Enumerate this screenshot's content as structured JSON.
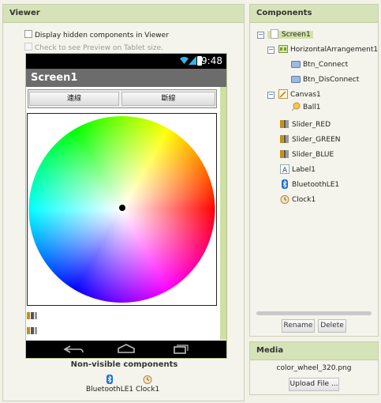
{
  "viewer": {
    "title": "Viewer",
    "hidden_components_label": "Display hidden components in Viewer",
    "tablet_preview_label": "Check to see Preview on Tablet size.",
    "phone": {
      "status_time": "9:48",
      "screen_title": "Screen1",
      "btn_connect_label": "連線",
      "btn_disconnect_label": "斷線"
    },
    "nonvisible_title": "Non-visible components",
    "nonvisible": [
      "BluetoothLE1",
      "Clock1"
    ]
  },
  "components": {
    "title": "Components",
    "tree": {
      "screen1": "Screen1",
      "harr": "HorizontalArrangement1",
      "btn_connect": "Btn_Connect",
      "btn_disconnect": "Btn_DisConnect",
      "canvas": "Canvas1",
      "ball": "Ball1",
      "slider_red": "Slider_RED",
      "slider_green": "Slider_GREEN",
      "slider_blue": "Slider_BLUE",
      "label": "Label1",
      "bluetooth": "BluetoothLE1",
      "clock": "Clock1"
    },
    "rename_label": "Rename",
    "delete_label": "Delete"
  },
  "media": {
    "title": "Media",
    "file": "color_wheel_320.png",
    "upload_label": "Upload File ..."
  },
  "colors": {
    "panel_header": "#d6e3b8",
    "selection": "#d3e3a7",
    "scroll_track": "#cfe0a2"
  }
}
